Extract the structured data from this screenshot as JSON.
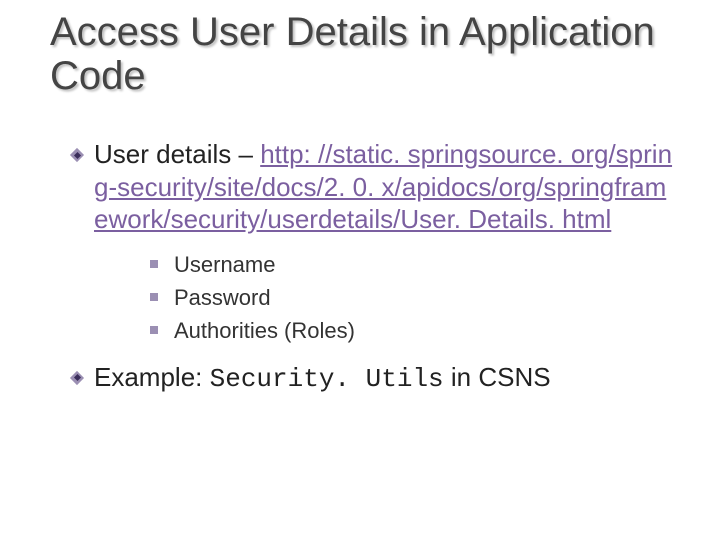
{
  "title": "Access User Details in Application Code",
  "bullets": {
    "item1_prefix": "User details – ",
    "item1_link": "http: //static. springsource. org/spring-security/site/docs/2. 0. x/apidocs/org/springframework/security/userdetails/User. Details. html",
    "sub": {
      "a": "Username",
      "b": "Password",
      "c": "Authorities (Roles)"
    },
    "item2_prefix": "Example: ",
    "item2_code": "Security. Utils",
    "item2_suffix": " in CSNS"
  }
}
